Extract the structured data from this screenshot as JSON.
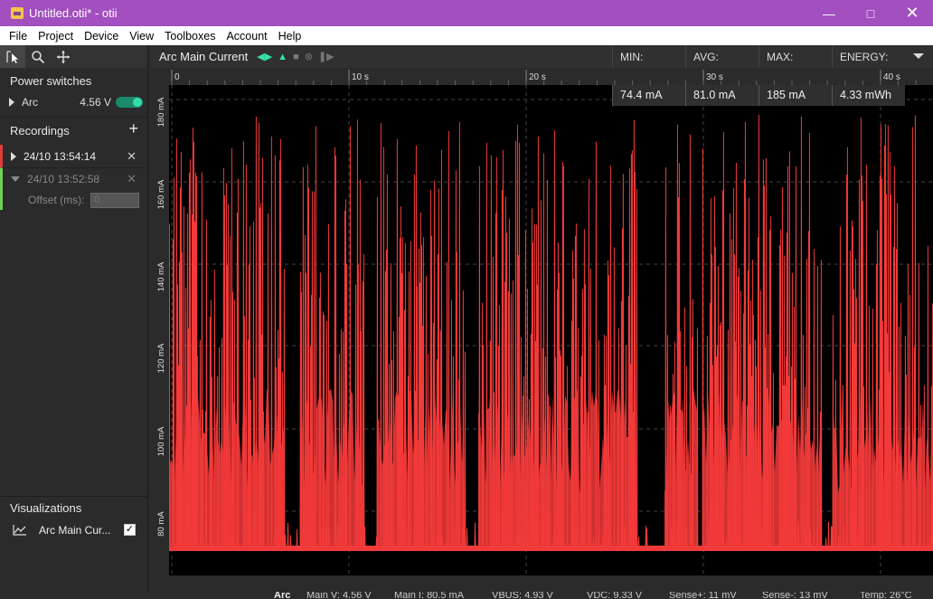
{
  "window": {
    "title": "Untitled.otii* - otii"
  },
  "menu": [
    "File",
    "Project",
    "Device",
    "View",
    "Toolboxes",
    "Account",
    "Help"
  ],
  "sidebar": {
    "power_title": "Power switches",
    "switch": {
      "name": "Arc",
      "voltage": "4.56 V"
    },
    "recordings_title": "Recordings",
    "recordings": [
      {
        "label": "24/10 13:54:14"
      },
      {
        "label": "24/10 13:52:58"
      }
    ],
    "offset_label": "Offset (ms):",
    "offset_placeholder": "0",
    "viz_title": "Visualizations",
    "viz_item": "Arc Main Cur..."
  },
  "plot": {
    "label": "Arc Main Current",
    "stats_headers": [
      "MIN:",
      "AVG:",
      "MAX:",
      "ENERGY:"
    ],
    "stats_values": [
      "74.4 mA",
      "81.0 mA",
      "185 mA",
      "4.33 mWh"
    ],
    "x_ticks": [
      "0",
      "10 s",
      "20 s",
      "30 s",
      "40 s"
    ],
    "y_ticks": [
      "180 mA",
      "160 mA",
      "140 mA",
      "120 mA",
      "100 mA",
      "80 mA"
    ]
  },
  "status": {
    "device": "Arc",
    "items": [
      "Main V: 4.56 V",
      "Main I: 80.5 mA",
      "VBUS: 4.93 V",
      "VDC: 9.33 V",
      "Sense+: 11 mV",
      "Sense-: 13 mV",
      "Temp: 26°C"
    ]
  },
  "colors": {
    "titlebar": "#a24fbf",
    "trace": "#f23a3a",
    "toggle": "#35e0a8"
  }
}
